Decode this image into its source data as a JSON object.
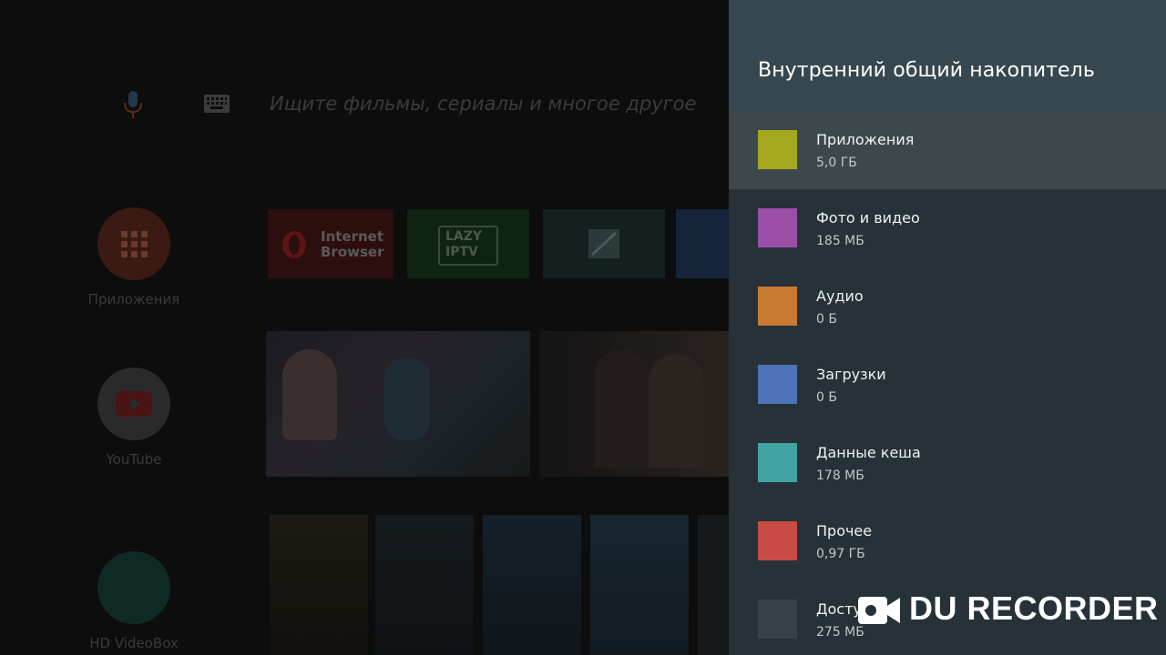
{
  "launcher": {
    "search_hint": "Ищите фильмы, сериалы и многое другое",
    "nav": [
      {
        "label": "Приложения"
      },
      {
        "label": "YouTube"
      },
      {
        "label": "HD VideoBox"
      }
    ],
    "apps": {
      "browser_line1": "Internet",
      "browser_line2": "Browser",
      "iptv_line1": "LAZY",
      "iptv_line2": "IPTV"
    }
  },
  "storage": {
    "title": "Внутренний общий накопитель",
    "items": [
      {
        "label": "Приложения",
        "size": "5,0 ГБ",
        "color": "#a6a81d"
      },
      {
        "label": "Фото и видео",
        "size": "185 МБ",
        "color": "#9c4fa8"
      },
      {
        "label": "Аудио",
        "size": "0 Б",
        "color": "#c87a33"
      },
      {
        "label": "Загрузки",
        "size": "0 Б",
        "color": "#4d74b8"
      },
      {
        "label": "Данные кеша",
        "size": "178 МБ",
        "color": "#42a3a3"
      },
      {
        "label": "Прочее",
        "size": "0,97 ГБ",
        "color": "#c74a43"
      },
      {
        "label": "Досту",
        "size": "275 МБ",
        "color": "#6a6f72"
      }
    ]
  },
  "recorder": {
    "watermark": "DU RECORDER"
  },
  "colors": {
    "panel_bg": "#263238",
    "panel_header": "#37474f",
    "focus_row": "#3d484d"
  }
}
